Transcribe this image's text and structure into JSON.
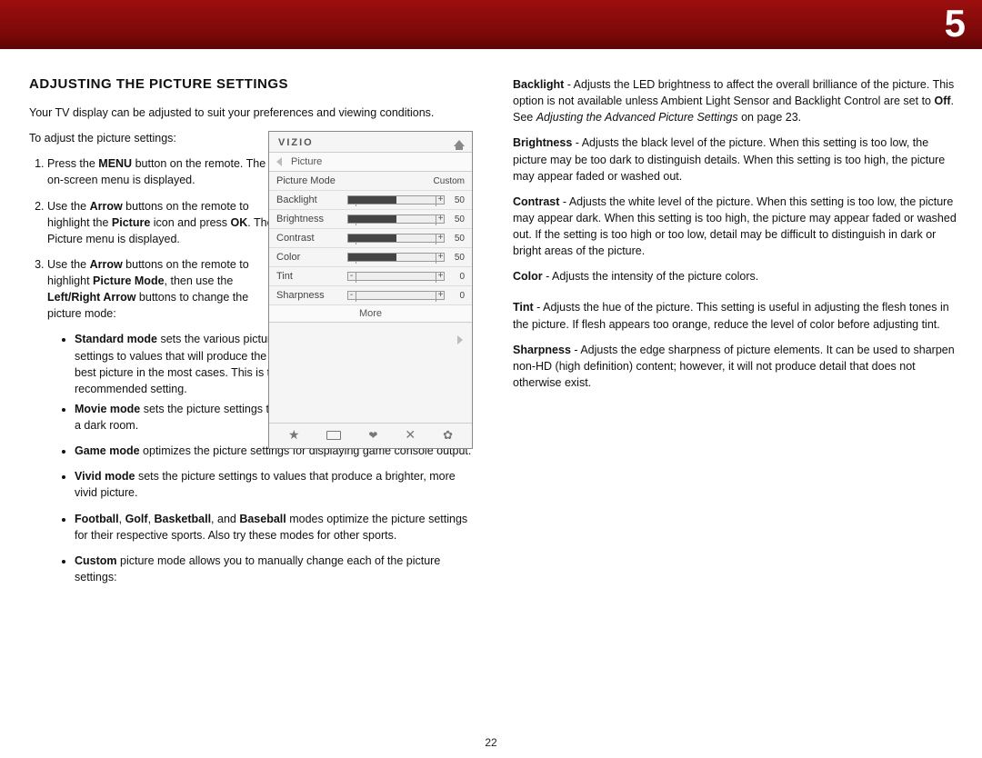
{
  "chapter": "5",
  "page_number": "22",
  "left": {
    "heading": "ADJUSTING THE PICTURE SETTINGS",
    "intro": "Your TV display can be adjusted to suit your preferences and viewing conditions.",
    "lead": "To adjust the picture settings:",
    "steps": {
      "s1a": "Press the ",
      "s1b": "MENU",
      "s1c": " button on the remote. The on-screen menu is displayed.",
      "s2a": "Use the ",
      "s2b": "Arrow",
      "s2c": " buttons on the remote to highlight the ",
      "s2d": "Picture",
      "s2e": " icon and press ",
      "s2f": "OK",
      "s2g": ". The Picture menu is displayed.",
      "s3a": "Use the ",
      "s3b": "Arrow",
      "s3c": " buttons on the remote to highlight ",
      "s3d": "Picture Mode",
      "s3e": ", then use the ",
      "s3f": "Left/Right Arrow",
      "s3g": " buttons to change the picture mode:"
    },
    "modes": {
      "std_b": "Standard mode",
      "std": " sets the various picture settings to values that will produce the best picture in the most cases. This is the recommended setting.",
      "mov_b": "Movie mode",
      "mov": " sets the picture settings to values perfect for watching a movie in a dark room.",
      "gam_b": "Game mode",
      "gam": " optimizes the picture settings for displaying game console output.",
      "viv_b": "Vivid mode",
      "viv": " sets the picture settings to values that produce a brighter, more vivid picture.",
      "sport_b1": "Football",
      "sport_s1": ", ",
      "sport_b2": "Golf",
      "sport_s2": ", ",
      "sport_b3": "Basketball",
      "sport_s3": ", and ",
      "sport_b4": "Baseball",
      "sport_t": " modes optimize the picture settings for their respective sports. Also try these modes for other sports.",
      "cus_b": "Custom",
      "cus": " picture mode allows you to manually change each of the picture settings:"
    }
  },
  "right": {
    "bl_b": "Backlight",
    "bl_t": " - Adjusts the LED brightness to affect the overall brilliance of the picture. This option is not available unless Ambient Light Sensor and Backlight Control are set to ",
    "bl_off": "Off",
    "bl_t2": ". See ",
    "bl_i": "Adjusting the Advanced Picture Settings",
    "bl_t3": " on page 23.",
    "br_b": "Brightness",
    "br_t": " - Adjusts the black level of the picture. When this setting is too low, the picture may be too dark to distinguish details. When this setting is too high, the picture may appear faded or washed out.",
    "co_b": "Contrast",
    "co_t": " - Adjusts the white level of the picture. When this setting is too low, the picture may appear dark. When this setting is too high, the picture may appear faded or washed out. If the setting is too high or too low, detail may be difficult to distinguish in dark or bright areas of the picture.",
    "cl_b": "Color",
    "cl_t": " - Adjusts the intensity of the picture colors.",
    "ti_b": "Tint",
    "ti_t": " - Adjusts the hue of the picture. This setting is useful in adjusting the flesh tones in the picture. If flesh appears too orange, reduce the level of color before adjusting tint.",
    "sh_b": "Sharpness",
    "sh_t": " - Adjusts the edge sharpness of picture elements. It can be used to sharpen non-HD (high definition) content; however, it will not produce detail that does not otherwise exist."
  },
  "osd": {
    "logo": "VIZIO",
    "crumb": "Picture",
    "mode_label": "Picture Mode",
    "mode_value": "Custom",
    "rows": [
      {
        "label": "Backlight",
        "value": "50",
        "pct": 50
      },
      {
        "label": "Brightness",
        "value": "50",
        "pct": 50
      },
      {
        "label": "Contrast",
        "value": "50",
        "pct": 50
      },
      {
        "label": "Color",
        "value": "50",
        "pct": 50
      },
      {
        "label": "Tint",
        "value": "0",
        "pct": 0
      },
      {
        "label": "Sharpness",
        "value": "0",
        "pct": 0
      }
    ],
    "more": "More"
  }
}
